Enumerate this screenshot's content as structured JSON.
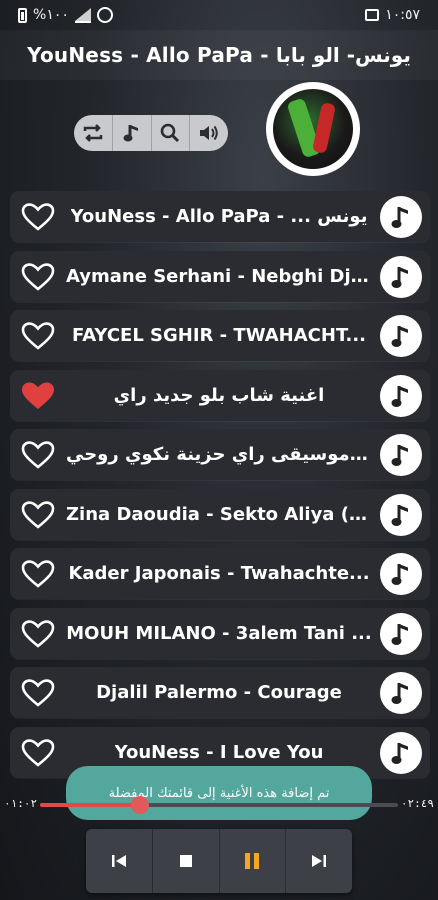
{
  "status_bar": {
    "battery": "%١٠٠",
    "time": "١٠:٥٧"
  },
  "header": {
    "title": "YouNess - Allo PaPa - يونس- الو بابا"
  },
  "controls": [
    {
      "icon": "repeat-icon",
      "glyph": "⇆"
    },
    {
      "icon": "music-note-icon",
      "glyph": "♪"
    },
    {
      "icon": "search-icon",
      "glyph": "⌕"
    },
    {
      "icon": "volume-icon",
      "glyph": "🔊"
    }
  ],
  "songs": [
    {
      "title": "YouNess - Allo PaPa - ... يونس",
      "favorite": false
    },
    {
      "title": "Aymane Serhani - Nebghi Dji...",
      "favorite": false
    },
    {
      "title": "FAYCEL SGHIR - TWAHACHT...",
      "favorite": false
    },
    {
      "title": "اغنية شاب بلو جديد راي",
      "favorite": true
    },
    {
      "title": "موسيقى راي حزينة نكوي روحي - ...",
      "favorite": false
    },
    {
      "title": "Zina Daoudia - Sekto Aliya (2...",
      "favorite": false
    },
    {
      "title": "Kader Japonais - Twahachte...",
      "favorite": false
    },
    {
      "title": "MOUH MILANO - 3alem Tani ...",
      "favorite": false
    },
    {
      "title": "Djalil Palermo - Courage",
      "favorite": false
    },
    {
      "title": "YouNess - I Love You",
      "favorite": false
    }
  ],
  "player": {
    "elapsed": "٠١:٠٢",
    "duration": "٠٢:٤٩",
    "progress_fraction": 0.28
  },
  "toast": {
    "message": "تم إضافة هذه الأغنية إلى قائمتك المفضلة"
  },
  "colors": {
    "accent_red": "#e14a4a",
    "toast_teal": "#53a79d",
    "favorite_heart": "#e0413f"
  }
}
